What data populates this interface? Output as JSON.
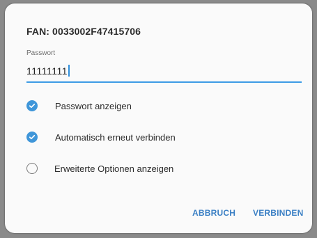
{
  "dialog": {
    "title": "FAN: 0033002F47415706",
    "password_label": "Passwort",
    "password_value": "11111111",
    "options": [
      {
        "label": "Passwort anzeigen",
        "checked": true
      },
      {
        "label": "Automatisch erneut verbinden",
        "checked": true
      },
      {
        "label": "Erweiterte Optionen anzeigen",
        "checked": false
      }
    ],
    "cancel_label": "ABBRUCH",
    "connect_label": "VERBINDEN"
  },
  "colors": {
    "accent": "#3d9be5",
    "button_text": "#3a7fc4",
    "background": "#fafafa"
  }
}
